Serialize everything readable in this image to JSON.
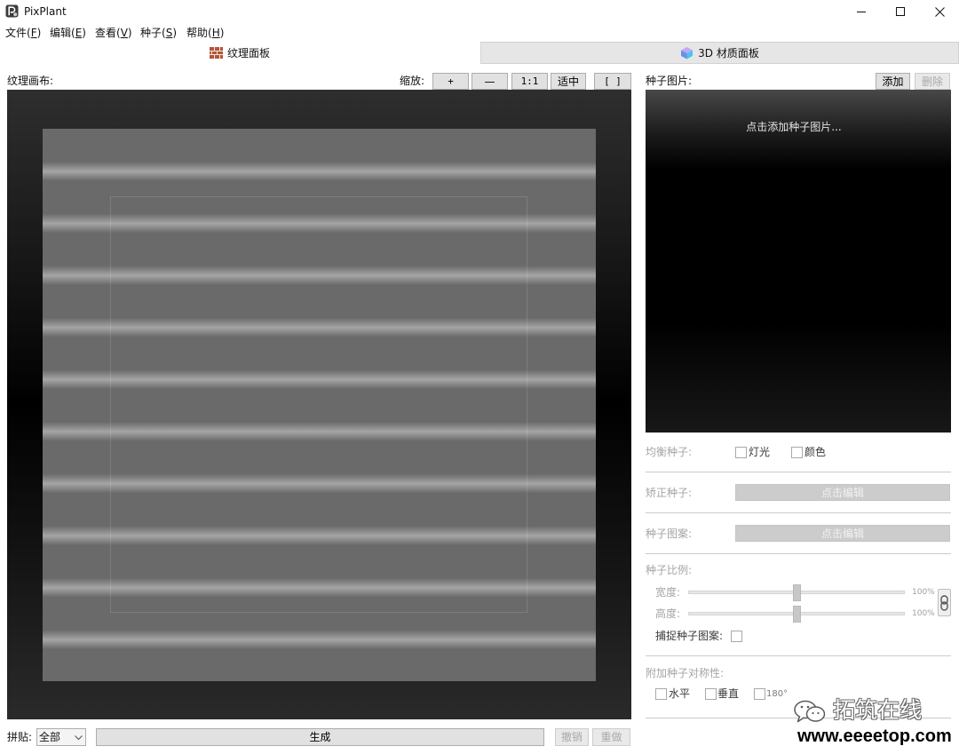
{
  "window": {
    "title": "PixPlant",
    "app_icon": "pixplant-logo-icon",
    "controls": [
      "minimize-icon",
      "maximize-icon",
      "close-icon"
    ]
  },
  "menu": {
    "items": [
      {
        "text": "文件(F)"
      },
      {
        "text": "编辑(E)"
      },
      {
        "text": "查看(V)"
      },
      {
        "text": "种子(S)"
      },
      {
        "text": "帮助(H)"
      }
    ]
  },
  "tabs": [
    {
      "label": "纹理面板",
      "icon": "brick-icon",
      "active": true
    },
    {
      "label": "3D 材质面板",
      "icon": "cube-icon",
      "active": false
    }
  ],
  "texture_panel": {
    "canvas_label": "纹理画布:",
    "zoom": {
      "label": "缩放:",
      "buttons": [
        "+",
        "—",
        "1:1",
        "适中",
        "[ ]"
      ]
    },
    "tiling": {
      "label": "拼贴:",
      "selected": "全部",
      "icon": "chevron-down-icon"
    },
    "generate": {
      "label": "生成",
      "enabled": true
    },
    "undo": {
      "label": "撤销",
      "enabled": false
    },
    "redo": {
      "label": "重做",
      "enabled": false
    }
  },
  "seed_panel": {
    "title": "种子图片:",
    "add": {
      "label": "添加",
      "enabled": true
    },
    "delete": {
      "label": "删除",
      "enabled": false
    },
    "placeholder": "点击添加种子图片...",
    "balance": {
      "label": "均衡种子:",
      "options": [
        {
          "label": "灯光",
          "checked": false
        },
        {
          "label": "颜色",
          "checked": false
        }
      ]
    },
    "correct": {
      "label": "矫正种子:",
      "button": "点击编辑"
    },
    "pattern": {
      "label": "种子图案:",
      "button": "点击编辑"
    },
    "scale": {
      "label": "种子比例:",
      "width": {
        "label": "宽度:",
        "value": "100%",
        "slider_level": 0.5
      },
      "height": {
        "label": "高度:",
        "value": "100%",
        "slider_level": 0.5
      },
      "link_icon": "chain-link-icon",
      "snap": {
        "label": "捕捉种子图案:",
        "checked": false
      }
    },
    "symmetry": {
      "label": "附加种子对称性:",
      "options": [
        {
          "label": "水平",
          "checked": false
        },
        {
          "label": "垂直",
          "checked": false
        },
        {
          "label": "180°",
          "checked": false
        }
      ]
    }
  },
  "watermark": {
    "icon": "wechat-icon",
    "name": "拓筑在线",
    "url": "www.eeeetop.com"
  }
}
